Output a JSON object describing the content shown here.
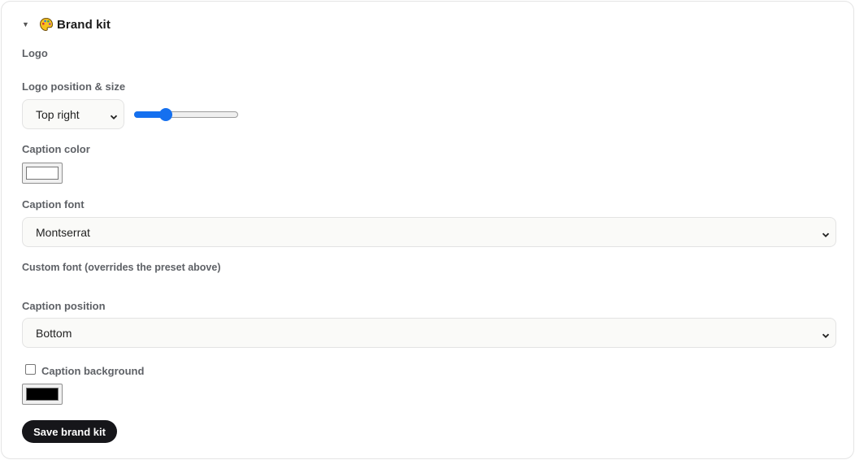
{
  "section": {
    "title": "Brand kit",
    "caret_icon": "caret-down-icon",
    "title_icon": "palette-icon"
  },
  "logo": {
    "label": "Logo"
  },
  "logo_position_size": {
    "label": "Logo position & size",
    "position_value": "Top right",
    "size_fraction": 0.28,
    "slider_color": "#1570ef"
  },
  "caption_color": {
    "label": "Caption color",
    "value": "#ffffff"
  },
  "caption_font": {
    "label": "Caption font",
    "value": "Montserrat"
  },
  "custom_font": {
    "label": "Custom font (overrides the preset above)"
  },
  "caption_position": {
    "label": "Caption position",
    "value": "Bottom"
  },
  "caption_background": {
    "label": "Caption background",
    "checked": false,
    "color": "#000000"
  },
  "actions": {
    "save_label": "Save brand kit",
    "save_bg": "#16161a"
  }
}
